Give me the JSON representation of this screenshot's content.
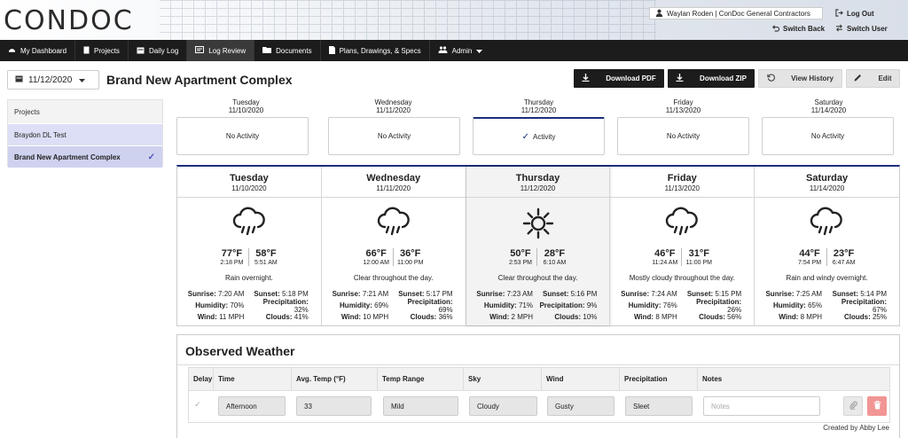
{
  "header": {
    "logo": "CONDOC",
    "user": "Waylan Roden  | ConDoc General Contractors",
    "logout": "Log Out",
    "switch_back": "Switch Back",
    "switch_user": "Switch User"
  },
  "nav": {
    "items": [
      {
        "label": "My Dashboard",
        "icon": "dashboard-icon"
      },
      {
        "label": "Projects",
        "icon": "document-icon"
      },
      {
        "label": "Daily Log",
        "icon": "calendar-icon"
      },
      {
        "label": "Log Review",
        "icon": "review-icon"
      },
      {
        "label": "Documents",
        "icon": "folder-icon"
      },
      {
        "label": "Plans, Drawings, & Specs",
        "icon": "file-icon"
      },
      {
        "label": "Admin",
        "icon": "users-icon"
      }
    ],
    "active_index": 3
  },
  "toolbar": {
    "date": "11/12/2020",
    "title": "Brand New Apartment Complex",
    "download_pdf": "Download PDF",
    "download_zip": "Download ZIP",
    "view_history": "View History",
    "edit": "Edit"
  },
  "sidebar": {
    "heading": "Projects",
    "items": [
      {
        "label": "Braydon DL Test",
        "active": false
      },
      {
        "label": "Brand New Apartment Complex",
        "active": true
      }
    ]
  },
  "days": [
    {
      "day": "Tuesday",
      "date": "11/10/2020",
      "activity": "No Activity",
      "has_activity": false
    },
    {
      "day": "Wednesday",
      "date": "11/11/2020",
      "activity": "No Activity",
      "has_activity": false
    },
    {
      "day": "Thursday",
      "date": "11/12/2020",
      "activity": "Activity",
      "has_activity": true
    },
    {
      "day": "Friday",
      "date": "11/13/2020",
      "activity": "No Activity",
      "has_activity": false
    },
    {
      "day": "Saturday",
      "date": "11/14/2020",
      "activity": "No Activity",
      "has_activity": false
    }
  ],
  "weather": [
    {
      "day": "Tuesday",
      "date": "11/10/2020",
      "icon": "rain-cloud-icon",
      "high": "77°F",
      "high_time": "2:18 PM",
      "low": "58°F",
      "low_time": "5:51 AM",
      "summary": "Rain overnight.",
      "sunrise": "7:20 AM",
      "sunset": "5:18 PM",
      "humidity": "70%",
      "precipitation": "32%",
      "wind": "11 MPH",
      "clouds": "41%"
    },
    {
      "day": "Wednesday",
      "date": "11/11/2020",
      "icon": "rain-cloud-icon",
      "high": "66°F",
      "high_time": "12:00 AM",
      "low": "36°F",
      "low_time": "11:00 PM",
      "summary": "Clear throughout the day.",
      "sunrise": "7:21 AM",
      "sunset": "5:17 PM",
      "humidity": "69%",
      "precipitation": "69%",
      "wind": "10 MPH",
      "clouds": "36%"
    },
    {
      "day": "Thursday",
      "date": "11/12/2020",
      "icon": "sun-icon",
      "high": "50°F",
      "high_time": "2:53 PM",
      "low": "28°F",
      "low_time": "6:10 AM",
      "summary": "Clear throughout the day.",
      "sunrise": "7:23 AM",
      "sunset": "5:16 PM",
      "humidity": "71%",
      "precipitation": "9%",
      "wind": "2 MPH",
      "clouds": "10%"
    },
    {
      "day": "Friday",
      "date": "11/13/2020",
      "icon": "rain-cloud-icon",
      "high": "46°F",
      "high_time": "11:24 AM",
      "low": "31°F",
      "low_time": "11:00 PM",
      "summary": "Mostly cloudy throughout the day.",
      "sunrise": "7:24 AM",
      "sunset": "5:15 PM",
      "humidity": "76%",
      "precipitation": "26%",
      "wind": "8 MPH",
      "clouds": "56%"
    },
    {
      "day": "Saturday",
      "date": "11/14/2020",
      "icon": "rain-cloud-icon",
      "high": "44°F",
      "high_time": "7:54 PM",
      "low": "23°F",
      "low_time": "6:47 AM",
      "summary": "Rain and windy overnight.",
      "sunrise": "7:25 AM",
      "sunset": "5:14 PM",
      "humidity": "65%",
      "precipitation": "67%",
      "wind": "8 MPH",
      "clouds": "25%"
    }
  ],
  "weather_labels": {
    "sunrise": "Sunrise:",
    "sunset": "Sunset:",
    "humidity": "Humidity:",
    "precipitation": "Precipitation:",
    "wind": "Wind:",
    "clouds": "Clouds:"
  },
  "observed": {
    "title": "Observed Weather",
    "columns": [
      "Delay",
      "Time",
      "Avg. Temp (°F)",
      "Temp Range",
      "Sky",
      "Wind",
      "Precipitation",
      "Notes"
    ],
    "row": {
      "time": "Afternoon",
      "avg_temp": "33",
      "temp_range": "Mild",
      "sky": "Cloudy",
      "wind": "Gusty",
      "precipitation": "Sleet",
      "notes_placeholder": "Notes"
    },
    "created_by": "Created by Abby Lee"
  }
}
